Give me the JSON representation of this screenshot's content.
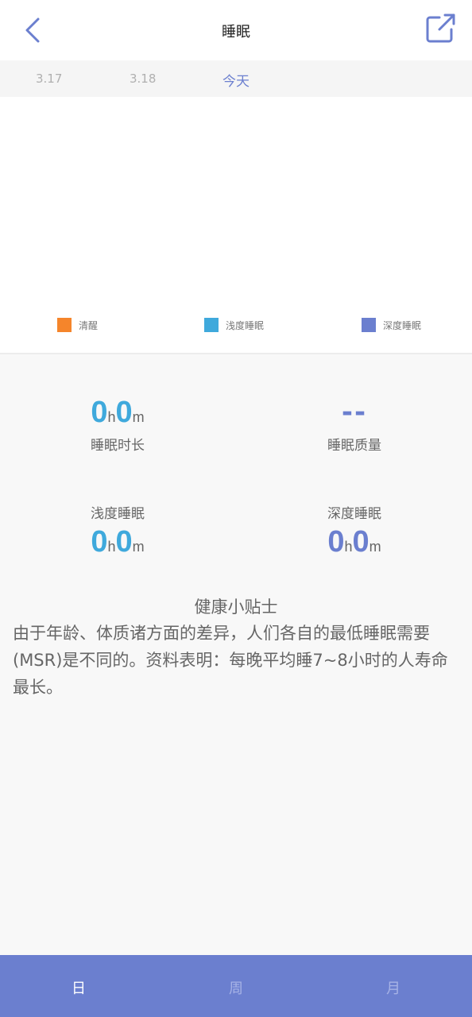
{
  "header": {
    "title": "睡眠",
    "back_icon": "chevron-left-icon",
    "share_icon": "external-link-icon",
    "accent_color": "#6b7fcf"
  },
  "dates": [
    {
      "label": "3.17",
      "active": false
    },
    {
      "label": "3.18",
      "active": false
    },
    {
      "label": "今天",
      "active": true
    }
  ],
  "legend": [
    {
      "label": "清醒",
      "color": "#f5852b"
    },
    {
      "label": "浅度睡眠",
      "color": "#3fa9dc"
    },
    {
      "label": "深度睡眠",
      "color": "#6b7fcf"
    }
  ],
  "stats": {
    "duration": {
      "hours": "0",
      "h_unit": "h",
      "minutes": "0",
      "m_unit": "m",
      "label": "睡眠时长",
      "color": "#3fa9dc"
    },
    "quality": {
      "value": "--",
      "label": "睡眠质量"
    },
    "light": {
      "hours": "0",
      "h_unit": "h",
      "minutes": "0",
      "m_unit": "m",
      "label": "浅度睡眠",
      "color": "#3fa9dc"
    },
    "deep": {
      "hours": "0",
      "h_unit": "h",
      "minutes": "0",
      "m_unit": "m",
      "label": "深度睡眠",
      "color": "#6b7fcf"
    }
  },
  "tip": {
    "title": "健康小贴士",
    "body": "由于年龄、体质诸方面的差异，人们各自的最低睡眠需要(MSR)是不同的。资料表明：每晚平均睡7~8小时的人寿命最长。"
  },
  "bottom_nav": [
    {
      "label": "日",
      "active": true
    },
    {
      "label": "周",
      "active": false
    },
    {
      "label": "月",
      "active": false
    }
  ]
}
